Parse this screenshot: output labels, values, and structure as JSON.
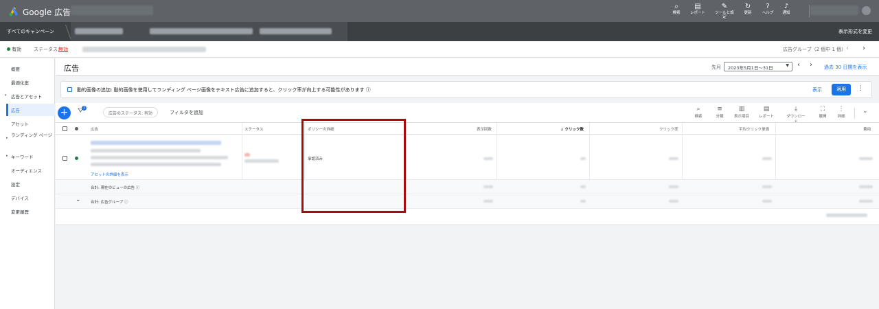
{
  "app": {
    "brand": "Google 広告"
  },
  "topnav": [
    {
      "icon": "search-icon",
      "glyph": "⌕",
      "label": "検索"
    },
    {
      "icon": "reports-icon",
      "glyph": "▤",
      "label": "レポート"
    },
    {
      "icon": "tools-icon",
      "glyph": "✎",
      "label": "ツールと設定"
    },
    {
      "icon": "refresh-icon",
      "glyph": "↻",
      "label": "更新"
    },
    {
      "icon": "help-icon",
      "glyph": "?",
      "label": "ヘルプ"
    },
    {
      "icon": "bell-icon",
      "glyph": "♪",
      "label": "通知"
    }
  ],
  "campaign_bar": {
    "all_campaigns": "すべてのキャンペーン",
    "view_toggle": "表示形式を変更"
  },
  "status_row": {
    "enabled": "有効",
    "status_label": "ステータス:",
    "status_value": "無効",
    "adgroup_count": "広告グループ（2 個中 1 個）",
    "prev": "‹",
    "next": "›"
  },
  "sidebar": {
    "items": [
      "概要",
      "最適化案",
      "広告とアセット",
      "広告",
      "アセット",
      "ランディング ページ",
      "キーワード",
      "オーディエンス",
      "設定",
      "デバイス",
      "変更履歴"
    ]
  },
  "header": {
    "title": "広告",
    "period": "先月",
    "date_range": "2023年5月1日～31日",
    "show_last30": "過去 30 日間を表示"
  },
  "banner": {
    "text": "動的画像の追加: 動的画像を使用してランディング ページ画像をテキスト広告に追加すると、クリック率が向上する可能性があります ⓘ",
    "show": "表示",
    "apply": "適用"
  },
  "toolbar": {
    "filter_badge": "1",
    "status_chip": "広告のステータス: 有効",
    "add_filter": "フィルタを追加",
    "tools": [
      {
        "icon": "search-icon",
        "glyph": "⌕",
        "label": "検索"
      },
      {
        "icon": "segment-icon",
        "glyph": "≡",
        "label": "分類"
      },
      {
        "icon": "columns-icon",
        "glyph": "▥",
        "label": "表示項目"
      },
      {
        "icon": "reports-icon",
        "glyph": "▤",
        "label": "レポート"
      },
      {
        "icon": "download-icon",
        "glyph": "⤓",
        "label": "ダウンロード"
      },
      {
        "icon": "expand-icon",
        "glyph": "⛶",
        "label": "展開"
      },
      {
        "icon": "more-icon",
        "glyph": "⋮",
        "label": "詳細"
      }
    ]
  },
  "table": {
    "headers": {
      "ad": "広告",
      "status": "ステータス",
      "policy": "ポリシーの詳細",
      "impressions": "表示回数",
      "clicks": "クリック数",
      "ctr": "クリック率",
      "avg_cpc": "平均クリック単価",
      "cost": "費用"
    },
    "row": {
      "asset_link": "アセットの詳細を表示",
      "policy": "承認済み"
    },
    "totals": [
      {
        "label": "合計: 現在のビューの広告 ⓘ"
      },
      {
        "label": "合計: 広告グループ ⓘ"
      }
    ]
  },
  "colors": {
    "accent": "#1a73e8",
    "highlight": "#a50e0e",
    "topbar": "#5f6368",
    "campaign_bar": "#3c4043"
  }
}
